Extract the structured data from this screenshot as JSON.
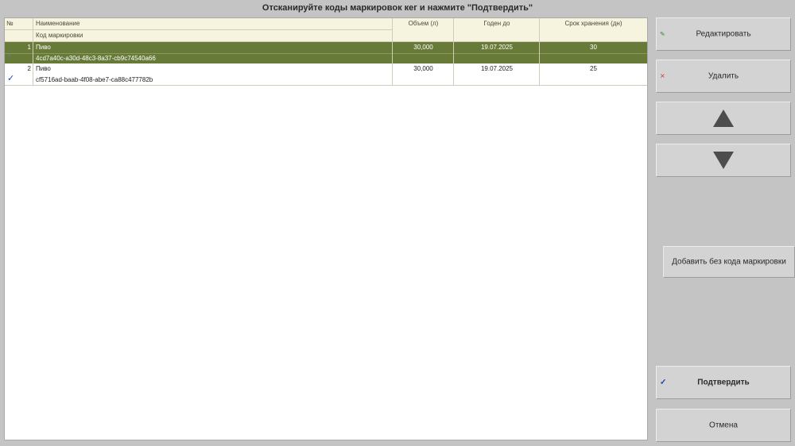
{
  "title": "Отсканируйте коды маркировок кег и нажмите \"Подтвердить\"",
  "table": {
    "headers": {
      "num": "№",
      "name": "Наименование",
      "code": "Код маркировки",
      "volume": "Объем (л)",
      "expiry": "Годен до",
      "shelf_life": "Срок хранения (дн)"
    },
    "rows": [
      {
        "num": "1",
        "check": "✓",
        "name": "Пиво",
        "code": "4cd7a40c-a30d-48c3-8a37-cb9c74540a66",
        "volume": "30,000",
        "expiry": "19.07.2025",
        "shelf_life": "30",
        "selected": true
      },
      {
        "num": "2",
        "check": "✓",
        "name": "Пиво",
        "code": "cf5716ad-baab-4f08-abe7-ca88c477782b",
        "volume": "30,000",
        "expiry": "19.07.2025",
        "shelf_life": "25",
        "selected": false
      }
    ]
  },
  "buttons": {
    "edit": {
      "label": "Редактировать",
      "icon": "✎"
    },
    "delete": {
      "label": "Удалить",
      "icon": "✕"
    },
    "add_without_code": {
      "label": "Добавить без кода маркировки"
    },
    "confirm": {
      "label": "Подтвердить",
      "icon": "✓"
    },
    "cancel": {
      "label": "Отмена"
    }
  },
  "colors": {
    "selected_row": "#677a38",
    "header_bg": "#f6f3de",
    "check_blue": "#1f3fbf",
    "edit_icon": "#2e8b2e",
    "delete_icon": "#d04040"
  }
}
